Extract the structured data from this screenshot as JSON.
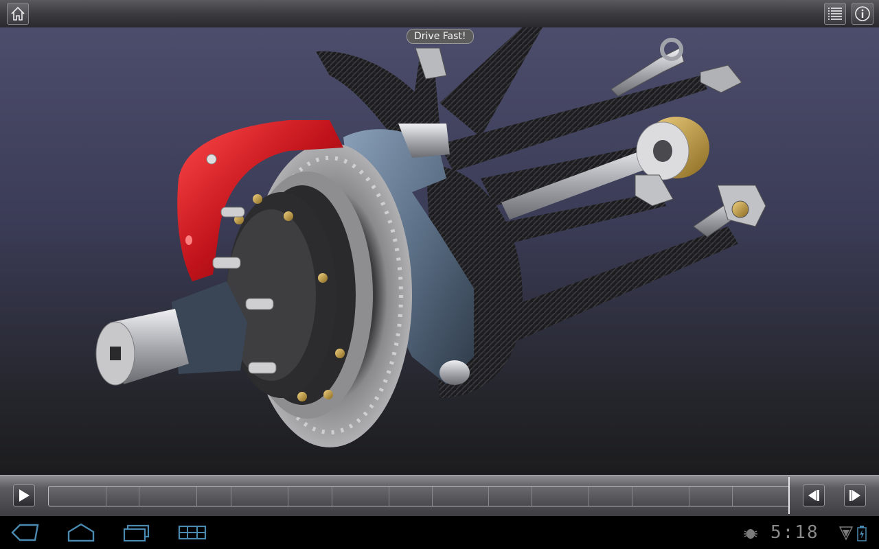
{
  "app": {
    "toolbar": {
      "home_icon": "home-icon",
      "menu_icon": "list-icon",
      "info_icon": "info-icon"
    },
    "viewport": {
      "caption": "Drive Fast!"
    },
    "timeline": {
      "play_icon": "play-icon",
      "prev_icon": "step-back-icon",
      "next_icon": "step-forward-icon",
      "position": 1.0
    }
  },
  "system_bar": {
    "back_icon": "back-icon",
    "home_icon": "home-icon",
    "recent_icon": "recent-apps-icon",
    "grid_icon": "app-grid-icon",
    "clock": "5:18",
    "status_icons": [
      "debug-icon",
      "signal-icon",
      "battery-icon"
    ]
  },
  "colors": {
    "caliper": "#c0121a",
    "carbon": "#1e1e20",
    "upright": "#5b6f86",
    "bolt": "#c8a040"
  }
}
